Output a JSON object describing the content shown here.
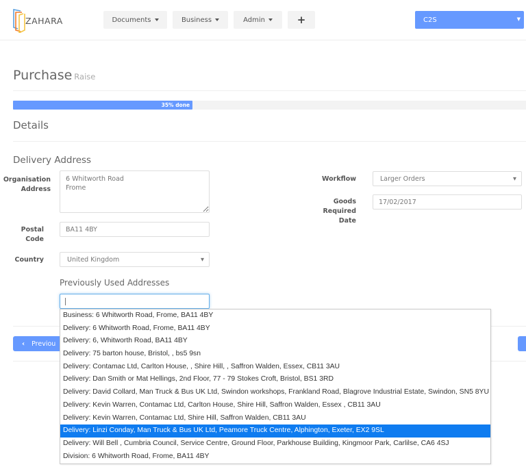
{
  "app": {
    "logo_text": "ZAHARA"
  },
  "nav": {
    "items": [
      {
        "label": "Documents",
        "has_caret": true
      },
      {
        "label": "Business",
        "has_caret": true
      },
      {
        "label": "Admin",
        "has_caret": true
      }
    ],
    "add_label": "+",
    "company_selector": {
      "value": "C2S",
      "arrow": "▼"
    }
  },
  "page": {
    "title": "Purchase",
    "subtitle": "Raise"
  },
  "progress": {
    "percent": 35,
    "label": "35% done"
  },
  "section": {
    "title": "Details",
    "delivery_title": "Delivery Address"
  },
  "form": {
    "organisation_address": {
      "label": "Organisation Address",
      "value": "6 Whitworth Road\nFrome"
    },
    "postal_code": {
      "label": "Postal Code",
      "value": "BA11 4BY"
    },
    "country": {
      "label": "Country",
      "value": "United Kingdom",
      "arrow": "▼"
    },
    "workflow": {
      "label": "Workflow",
      "value": "Larger Orders",
      "arrow": "▼"
    },
    "goods_required_date": {
      "label": "Goods Required Date",
      "value": "17/02/2017"
    },
    "previously_used": {
      "title": "Previously Used Addresses",
      "search_value": ""
    }
  },
  "buttons": {
    "previous_label": "Previou",
    "previous_icon": "‹"
  },
  "dropdown": {
    "selected_index": 9,
    "options": [
      "Business: 6 Whitworth Road, Frome, BA11 4BY",
      "Delivery: 6 Whitworth Road, Frome, BA11 4BY",
      "Delivery: 6, Whitworth Road, BA11 4BY",
      "Delivery: 75 barton house, Bristol, , bs5 9sn",
      "Delivery: Contamac Ltd, Carlton House, , Shire Hill, , Saffron Walden, Essex, CB11 3AU",
      "Delivery: Dan Smith or Mat Hellings, 2nd Floor, 77 - 79 Stokes Croft, Bristol, BS1 3RD",
      "Delivery: David Collard, Man Truck & Bus UK Ltd, Swindon workshops, Frankland Road, Blagrove Industrial Estate, Swindon, SN5 8YU",
      "Delivery: Kevin Warren, Contamac Ltd, Carlton House, Shire Hill, Saffron Walden, Essex , CB11 3AU",
      "Delivery: Kevin Warren, Contamac Ltd, Shire Hill, Saffron Walden, CB11 3AU",
      "Delivery: Linzi Conday, Man Truck & Bus UK Ltd, Peamore Truck Centre, Alphington, Exeter, EX2 9SL",
      "Delivery: Will Bell , Cumbria Council, Service Centre, Ground Floor, Parkhouse Building, Kingmoor Park, Carlilse, CA6 4SJ",
      "Division: 6 Whitworth Road, Frome, BA11 4BY"
    ]
  },
  "colors": {
    "accent": "#6699ff",
    "selected_option": "#0f7cf0",
    "focus_border": "#66afe9"
  }
}
